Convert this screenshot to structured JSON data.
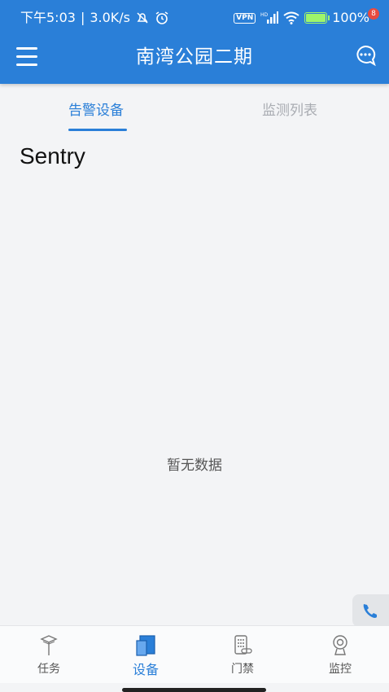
{
  "status_bar": {
    "time": "下午5:03",
    "speed": "3.0K/s",
    "vpn": "VPN",
    "network": "HD",
    "battery": "100%"
  },
  "header": {
    "title": "南湾公园二期",
    "message_count": "8"
  },
  "tabs": [
    {
      "label": "告警设备",
      "active": true
    },
    {
      "label": "监测列表",
      "active": false
    }
  ],
  "content": {
    "section_title": "Sentry",
    "empty_text": "暂无数据"
  },
  "bottom_nav": [
    {
      "label": "任务",
      "icon": "task-icon",
      "active": false
    },
    {
      "label": "设备",
      "icon": "device-icon",
      "active": true
    },
    {
      "label": "门禁",
      "icon": "access-control-icon",
      "active": false
    },
    {
      "label": "监控",
      "icon": "camera-icon",
      "active": false
    }
  ],
  "colors": {
    "primary": "#2a7fd8",
    "background": "#f3f4f6",
    "badge": "#e84a3f"
  }
}
